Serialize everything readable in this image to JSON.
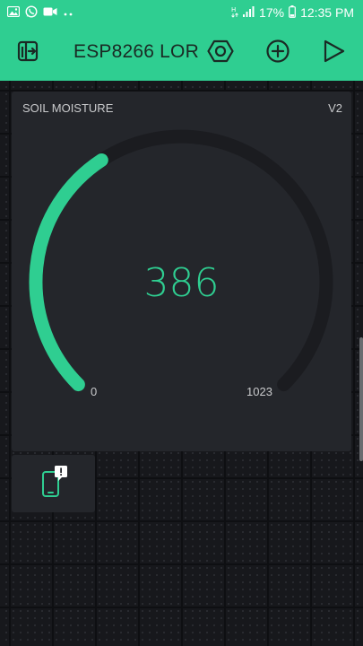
{
  "status_bar": {
    "battery": "17%",
    "time": "12:35 PM",
    "icons": [
      "gallery-icon",
      "whatsapp-icon",
      "video-icon",
      "more-dots-icon",
      "h-plus-network-icon",
      "signal-icon",
      "battery-icon"
    ]
  },
  "app_bar": {
    "title": "ESP8266 LOR",
    "icons": [
      "exit-project-icon",
      "settings-nut-icon",
      "add-widget-icon",
      "play-icon"
    ]
  },
  "gauge": {
    "label": "SOIL MOISTURE",
    "pin": "V2",
    "value": "386",
    "min": "0",
    "max": "1023",
    "level_fraction": 0.377,
    "accent_color": "#2fce91",
    "track_color": "#1b1c20"
  },
  "device_widget": {
    "icon": "device-alert-icon"
  },
  "colors": {
    "brand": "#2fce91",
    "background": "#17181c",
    "widget": "#24262b"
  }
}
